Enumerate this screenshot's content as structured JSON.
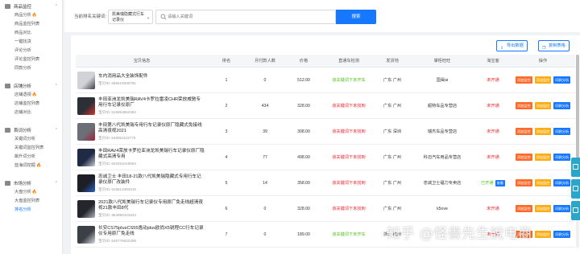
{
  "sidebar": {
    "groups": [
      {
        "label": "商品监控",
        "items": [
          {
            "label": "商品分析",
            "fire": true
          },
          {
            "label": "商品监控列表"
          },
          {
            "label": "商品对比"
          },
          {
            "label": "一键找货"
          },
          {
            "label": "评论分析"
          },
          {
            "label": "评论监控列表"
          },
          {
            "label": "同款分析"
          }
        ]
      },
      {
        "label": "店铺分析",
        "items": [
          {
            "label": "店铺透视",
            "fire": true
          },
          {
            "label": "店铺监控列表"
          },
          {
            "label": "店铺对比"
          }
        ]
      },
      {
        "label": "首词分析",
        "items": [
          {
            "label": "关键词分析"
          },
          {
            "label": "关键词监控列表"
          },
          {
            "label": "飙升词分析"
          },
          {
            "label": "蓝海词挖掘",
            "fire": true
          }
        ]
      },
      {
        "label": "市场分析",
        "items": [
          {
            "label": "大盘分析",
            "fire": true
          },
          {
            "label": "大盘监控列表"
          },
          {
            "label": "排名分析",
            "active": true
          }
        ]
      }
    ]
  },
  "search": {
    "label": "当前排名关键词:",
    "selected": "凯美瑞隐藏式行车记录仪",
    "placeholder": "请输入关键词",
    "button": "搜索"
  },
  "toolbar": {
    "export_label": "导出数据",
    "copy_label": "复制表格"
  },
  "table": {
    "headers": [
      "宝贝信息",
      "排名",
      "月付款人数",
      "价格",
      "直通车检测",
      "发货地",
      "掌柜旺旺",
      "淘宝客",
      "操作"
    ],
    "ops": [
      "添加监控",
      "添加监控",
      "同款分析"
    ],
    "rows": [
      {
        "title": "车内消用品大全装饰配件",
        "id": "宝贝ID: 656416090781",
        "rank": "1",
        "month": "0",
        "price": "512.00",
        "check": "该关键词下未开车",
        "check_color": "#52c41a",
        "loc": "广东 广州",
        "shop": "国昊ai",
        "tb": "未开通",
        "tb_tag": "",
        "thumb": [
          "#d0d3d8",
          "#3a3f47"
        ]
      },
      {
        "title": "丰田亚洲龙凯美瑞RAV4卡罗拉雷凌CHR荣放威驰专用行车记录仪原厂",
        "id": "宝贝ID: 615653662384",
        "rank": "2",
        "month": "434",
        "price": "328.00",
        "check": "该关键词下未找到",
        "check_color": "#f5222d",
        "loc": "广东 广州",
        "shop": "超特车品专营店",
        "tb": "未开通",
        "tb_tag": "",
        "thumb": [
          "#2b2f36",
          "#d8342f"
        ]
      },
      {
        "title": "丰田第八代凯美瑞专用行车记录仪原厂隐藏式免接线高清夜视2021",
        "id": "宝贝ID: 649061116770",
        "rank": "3",
        "month": "39",
        "price": "308.00",
        "check": "该关键词下未找到",
        "check_color": "#f5222d",
        "loc": "广东 深圳",
        "shop": "瑞杰车品专营店",
        "tb": "未开通",
        "tb_tag": "",
        "thumb": [
          "#6b6f78",
          "#9d2235"
        ]
      },
      {
        "title": "丰田RAV4荣放卡罗拉亚洲龙凯美瑞行车记录仪原厂隐藏式高清专用",
        "id": "宝贝ID: 620453419504",
        "rank": "4",
        "month": "77",
        "price": "498.00",
        "check": "该关键词下未找到",
        "check_color": "#f5222d",
        "loc": "广东 广州",
        "shop": "科迈汽车用品专营店",
        "tb": "未开通",
        "tb_tag": "",
        "thumb": [
          "#1f2a44",
          "#c9ccd2"
        ]
      },
      {
        "title": "忠诚卫士 丰田18-21款八代凯美瑞隐藏式专用行车记录仪原厂改装件",
        "id": "宝贝ID: 615513483215",
        "rank": "5",
        "month": "14",
        "price": "358.00",
        "check": "该关键词下未找到",
        "check_color": "#f5222d",
        "loc": "广东 广州",
        "shop": "忠诚卫士福力专卖店",
        "tb": "已开通",
        "tb_tag": "查看",
        "thumb": [
          "#1c1f26",
          "#2a64c8"
        ]
      },
      {
        "title": "2021款八代凯美瑞行车记录仪专用原厂免走线超清夜视21款丰田8代",
        "id": "宝贝ID: 654990441644",
        "rank": "6",
        "month": "0",
        "price": "328.00",
        "check": "该关键词下未找到",
        "check_color": "#f5222d",
        "loc": "广东 广州",
        "shop": "k5ove",
        "tb": "未开通",
        "tb_tag": "",
        "thumb": [
          "#23262c",
          "#b1b4ba"
        ]
      },
      {
        "title": "长安CS75plusCS55逸动plus欧尚X5锐程CC行车记录仪专用原厂免走线",
        "id": "宝贝ID: 645776632299",
        "rank": "7",
        "month": "0",
        "price": "189.00",
        "check": "该关键词下未开车",
        "check_color": "#52c41a",
        "loc": "浙江 杭州",
        "shop": "",
        "tb": "未开通",
        "tb_tag": "",
        "thumb": [
          "#3b3f46",
          "#d9dbe0"
        ]
      }
    ]
  },
  "watermark": "知乎 @怪兽先生說电商",
  "colors": {
    "accent": "#1677ff",
    "danger": "#f5222d",
    "success": "#52c41a",
    "op_orange": "#ff6a2a",
    "op_yellow": "#faad14",
    "float": "#2ba6cb"
  }
}
